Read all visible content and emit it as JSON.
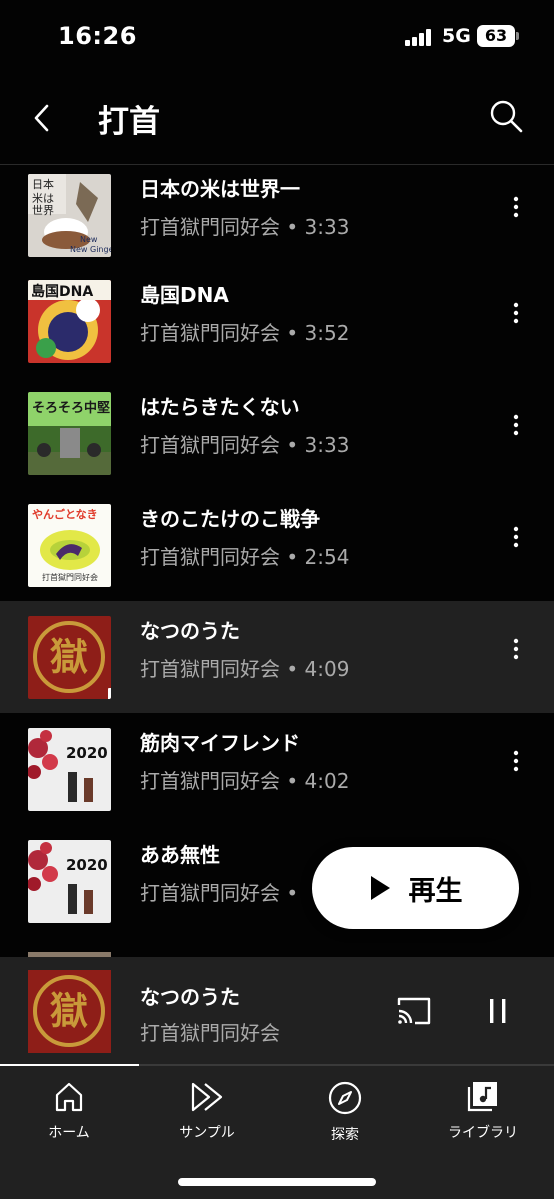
{
  "status_bar": {
    "time": "16:26",
    "network": "5G",
    "battery": "63"
  },
  "header": {
    "title": "打首"
  },
  "songs": [
    {
      "title": "日本の米は世界一",
      "meta": "打首獄門同好会 • 3:33",
      "art_text": "New Gingeration"
    },
    {
      "title": "島国DNA",
      "meta": "打首獄門同好会 • 3:52",
      "art_text": "島国DNA"
    },
    {
      "title": "はたらきたくない",
      "meta": "打首獄門同好会 • 3:33",
      "art_text": "そろそろ中堅"
    },
    {
      "title": "きのこたけのこ戦争",
      "meta": "打首獄門同好会 • 2:54",
      "art_text": "やんごとなき"
    },
    {
      "title": "なつのうた",
      "meta": "打首獄門同好会 • 4:09",
      "art_text": "獄"
    },
    {
      "title": "筋肉マイフレンド",
      "meta": "打首獄門同好会 • 4:02",
      "art_text": "2020"
    },
    {
      "title": "ああ無性",
      "meta": "打首獄門同好会 • ",
      "art_text": "2020"
    }
  ],
  "play_button": {
    "label": "再生"
  },
  "mini_player": {
    "title": "なつのうた",
    "artist": "打首獄門同好会",
    "progress": 0.25,
    "art_text": "獄"
  },
  "nav": [
    {
      "label": "ホーム",
      "icon": "home-icon"
    },
    {
      "label": "サンプル",
      "icon": "samples-icon"
    },
    {
      "label": "探索",
      "icon": "explore-icon"
    },
    {
      "label": "ライブラリ",
      "icon": "library-icon"
    }
  ],
  "colors": {
    "background": "#030303",
    "surface": "#212121",
    "secondary_text": "#aaaaaa",
    "accent": "#ffffff"
  }
}
